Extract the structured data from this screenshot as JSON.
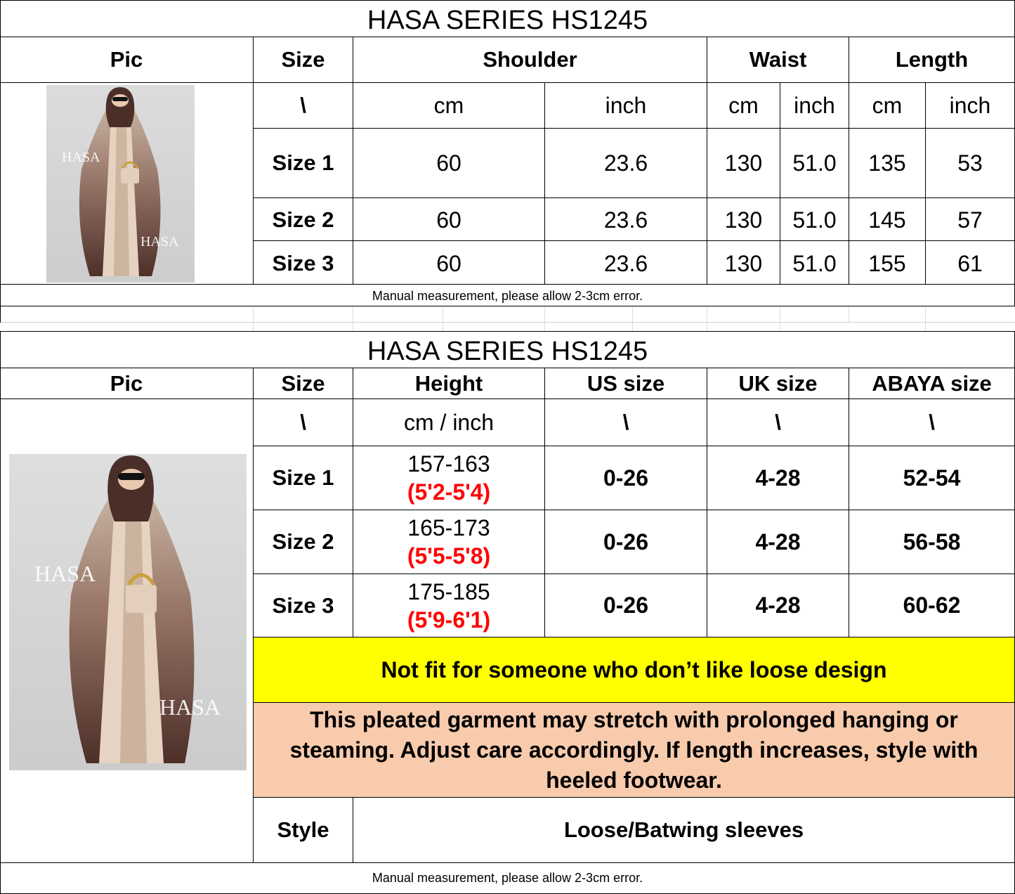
{
  "table1": {
    "title": "HASA SERIES HS1245",
    "headers": {
      "pic": "Pic",
      "size": "Size",
      "shoulder": "Shoulder",
      "waist": "Waist",
      "length": "Length"
    },
    "units": {
      "size": "\\",
      "cm": "cm",
      "inch": "inch"
    },
    "rows": [
      {
        "label": "Size 1",
        "shoulder_cm": "60",
        "shoulder_in": "23.6",
        "waist_cm": "130",
        "waist_in": "51.0",
        "length_cm": "135",
        "length_in": "53"
      },
      {
        "label": "Size 2",
        "shoulder_cm": "60",
        "shoulder_in": "23.6",
        "waist_cm": "130",
        "waist_in": "51.0",
        "length_cm": "145",
        "length_in": "57"
      },
      {
        "label": "Size 3",
        "shoulder_cm": "60",
        "shoulder_in": "23.6",
        "waist_cm": "130",
        "waist_in": "51.0",
        "length_cm": "155",
        "length_in": "61"
      }
    ],
    "note": "Manual measurement, please allow 2-3cm error.",
    "watermark": "HASA"
  },
  "table2": {
    "title": "HASA SERIES HS1245",
    "headers": {
      "pic": "Pic",
      "size": "Size",
      "height": "Height",
      "us": "US size",
      "uk": "UK size",
      "abaya": "ABAYA size"
    },
    "units": {
      "size": "\\",
      "height": "cm / inch",
      "us": "\\",
      "uk": "\\",
      "abaya": "\\"
    },
    "rows": [
      {
        "label": "Size 1",
        "height_cm": "157-163",
        "height_ft": "(5'2-5'4)",
        "us": "0-26",
        "uk": "4-28",
        "abaya": "52-54"
      },
      {
        "label": "Size 2",
        "height_cm": "165-173",
        "height_ft": "(5'5-5'8)",
        "us": "0-26",
        "uk": "4-28",
        "abaya": "56-58"
      },
      {
        "label": "Size 3",
        "height_cm": "175-185",
        "height_ft": "(5'9-6'1)",
        "us": "0-26",
        "uk": "4-28",
        "abaya": "60-62"
      }
    ],
    "fit_warning": "Not fit for someone who don’t like loose design",
    "care_note": "This pleated garment may stretch with prolonged hanging or steaming. Adjust care accordingly. If length increases, style with heeled footwear.",
    "style_label": "Style",
    "style_value": "Loose/Batwing sleeves",
    "note": "Manual measurement, please allow 2-3cm error.",
    "watermark": "HASA"
  },
  "colors": {
    "warning_bg": "#ffff00",
    "care_bg": "#f8cbad",
    "height_ft": "#ff0000",
    "grid": "#000000"
  }
}
